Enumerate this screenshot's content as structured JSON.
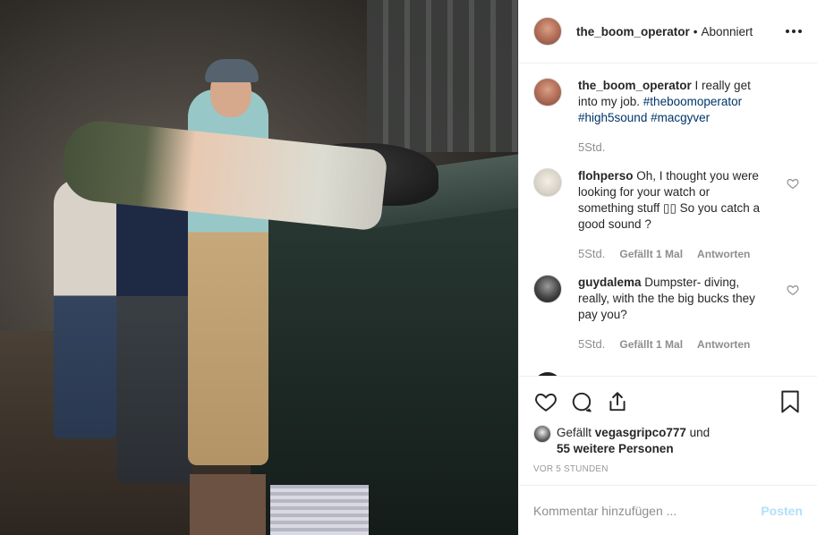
{
  "header": {
    "username": "the_boom_operator",
    "separator": "•",
    "follow_status": "Abonniert",
    "more_icon": "more-horizontal-icon"
  },
  "caption": {
    "username": "the_boom_operator",
    "text": "I really get into my job.",
    "hashtags": "#theboomoperator #high5sound #macgyver",
    "time": "5Std."
  },
  "comments": [
    {
      "username": "flohperso",
      "text": "Oh, I thought you were looking for your watch or something stuff ▯▯ So you catch a good sound ?",
      "time": "5Std.",
      "likes": "Gefällt 1 Mal",
      "reply": "Antworten"
    },
    {
      "username": "guydalema",
      "text": "Dumpster- diving, really, with the the big bucks they pay you?",
      "time": "5Std.",
      "likes": "Gefällt 1 Mal",
      "reply": "Antworten"
    }
  ],
  "actions": {
    "icons": [
      "heart-icon",
      "comment-icon",
      "share-icon",
      "bookmark-icon"
    ]
  },
  "liked_by": {
    "prefix": "Gefällt",
    "user": "vegasgripco777",
    "and": "und",
    "others": "55 weitere Personen"
  },
  "timestamp": "VOR 5 STUNDEN",
  "add_comment": {
    "placeholder": "Kommentar hinzufügen ...",
    "post_label": "Posten"
  },
  "colors": {
    "link": "#003569",
    "post_disabled": "#b2dffc",
    "secondary_text": "#8e8e8e",
    "border": "#efefef"
  }
}
